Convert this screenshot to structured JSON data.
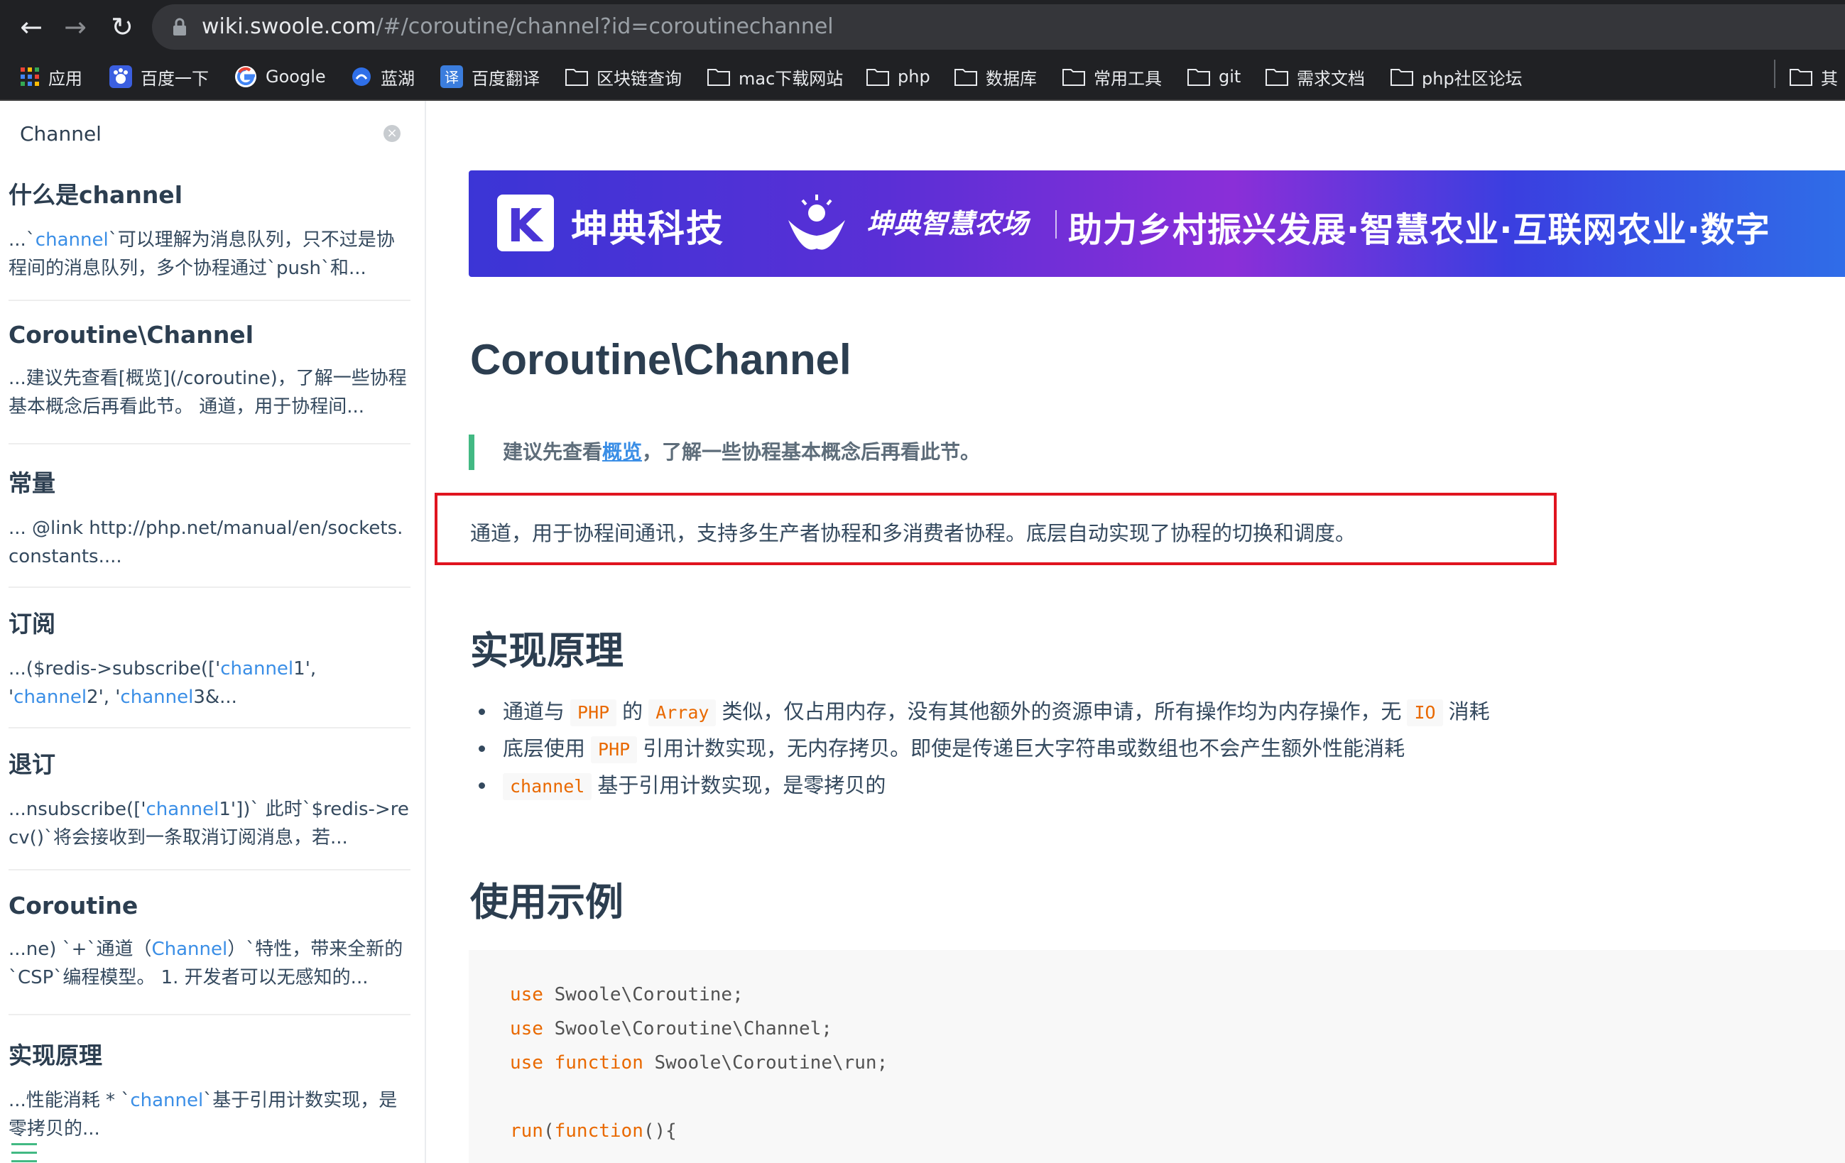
{
  "browser": {
    "url_host": "wiki.swoole.com",
    "url_path": "/#/coroutine/channel?id=coroutinechannel",
    "bookmarks": [
      {
        "label": "应用",
        "icon": "apps-grid-icon"
      },
      {
        "label": "百度一下",
        "icon": "baidu-paw-icon"
      },
      {
        "label": "Google",
        "icon": "google-g-icon"
      },
      {
        "label": "蓝湖",
        "icon": "lanhu-icon"
      },
      {
        "label": "百度翻译",
        "icon": "translate-icon"
      },
      {
        "label": "区块链查询",
        "icon": "folder-icon"
      },
      {
        "label": "mac下载网站",
        "icon": "folder-icon"
      },
      {
        "label": "php",
        "icon": "folder-icon"
      },
      {
        "label": "数据库",
        "icon": "folder-icon"
      },
      {
        "label": "常用工具",
        "icon": "folder-icon"
      },
      {
        "label": "git",
        "icon": "folder-icon"
      },
      {
        "label": "需求文档",
        "icon": "folder-icon"
      },
      {
        "label": "php社区论坛",
        "icon": "folder-icon"
      },
      {
        "label": "其",
        "icon": "folder-icon"
      }
    ]
  },
  "sidebar": {
    "search_value": "Channel",
    "results": [
      {
        "title": "什么是channel",
        "s": [
          "...`",
          "channel",
          "`可以理解为消息队列，只不过是协程间的消息队列，多个协程通过`push`和..."
        ]
      },
      {
        "title": "Coroutine\\Channel",
        "s": [
          "...建议先查看[概览](/coroutine)，了解一些协程基本概念后再看此节。 通道，用于协程间..."
        ]
      },
      {
        "title": "常量",
        "s": [
          "... @link http://php.net/manual/en/sockets.constants...."
        ]
      },
      {
        "title": "订阅",
        "s": [
          "...($redis->subscribe(['",
          "channel",
          "1', '",
          "channel",
          "2', '",
          "channel",
          "3&..."
        ]
      },
      {
        "title": "退订",
        "s": [
          "...nsubscribe(['",
          "channel",
          "1'])` 此时`$redis->recv()`将会接收到一条取消订阅消息，若..."
        ]
      },
      {
        "title": "Coroutine",
        "s": [
          "...ne) `+`通道（",
          "Channel",
          "）`特性，带来全新的`CSP`编程模型。 1. 开发者可以无感知的..."
        ]
      },
      {
        "title": "实现原理",
        "s": [
          "...性能消耗 * `",
          "channel",
          "`基于引用计数实现，是零拷贝的..."
        ]
      }
    ]
  },
  "banner": {
    "brand": "坤典科技",
    "farm": "坤典智慧农场",
    "slogan": "助力乡村振兴发展·智慧农业·互联网农业·数字"
  },
  "article": {
    "title": "Coroutine\\Channel",
    "tip_prefix": "建议先查看",
    "tip_link": "概览",
    "tip_suffix": "，了解一些协程基本概念后再看此节。",
    "intro": "通道，用于协程间通讯，支持多生产者协程和多消费者协程。底层自动实现了协程的切换和调度。",
    "section1": "实现原理",
    "bullets": [
      [
        "通道与",
        "PHP",
        "的",
        "Array",
        "类似，仅占用内存，没有其他额外的资源申请，所有操作均为内存操作，无",
        "IO",
        "消耗"
      ],
      [
        "底层使用",
        "PHP",
        "引用计数实现，无内存拷贝。即使是传递巨大字符串或数组也不会产生额外性能消耗"
      ],
      [
        "",
        "channel",
        "基于引用计数实现，是零拷贝的"
      ]
    ],
    "section2": "使用示例",
    "code": [
      [
        "use",
        " Swoole\\Coroutine;"
      ],
      [
        "use",
        " Swoole\\Coroutine\\Channel;"
      ],
      [
        "use",
        " ",
        "function",
        " Swoole\\Coroutine\\run;"
      ],
      [
        "run",
        "(",
        "function",
        "(){"
      ]
    ]
  }
}
